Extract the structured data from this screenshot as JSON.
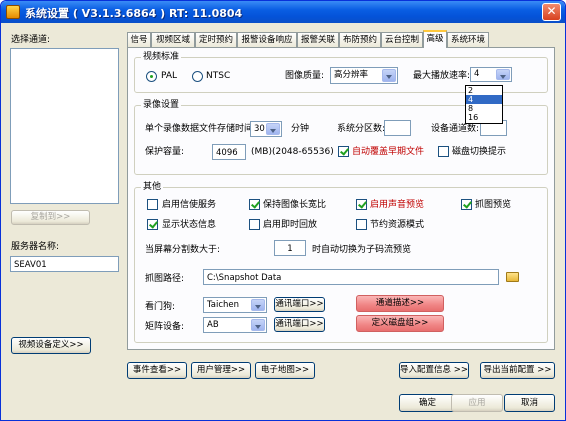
{
  "window": {
    "title": "系统设置 ( V3.1.3.6864 ) RT: 11.0804"
  },
  "left": {
    "select_channel_label": "选择通道:",
    "copy_to_button": "复制到>>",
    "server_name_label": "服务器名称:",
    "server_name_value": "SEAV01",
    "video_device_def_button": "视频设备定义>>"
  },
  "tabs": [
    {
      "label": "信号"
    },
    {
      "label": "视频区域"
    },
    {
      "label": "定时预约"
    },
    {
      "label": "报警设备响应"
    },
    {
      "label": "报警关联"
    },
    {
      "label": "布防预约"
    },
    {
      "label": "云台控制"
    },
    {
      "label": "高级"
    },
    {
      "label": "系统环境"
    }
  ],
  "video_std": {
    "group_title": "视频标准",
    "pal_label": "PAL",
    "ntsc_label": "NTSC",
    "quality_label": "图像质量:",
    "quality_value": "高分辨率",
    "max_rate_label": "最大播放速率:",
    "max_rate_value": "4",
    "rate_options": [
      "2",
      "4",
      "8",
      "16"
    ]
  },
  "record": {
    "group_title": "录像设置",
    "file_time_label": "单个录像数据文件存储时间:",
    "file_time_value": "30",
    "minutes_label": "分钟",
    "partitions_label": "系统分区数:",
    "partitions_value": "",
    "device_channels_label": "设备通道数:",
    "device_channels_value": "",
    "protect_label": "保护容量:",
    "protect_value": "4096",
    "protect_range": "(MB)(2048-65536)",
    "auto_overwrite_label": "自动覆盖早期文件",
    "disk_switch_label": "磁盘切换提示"
  },
  "other": {
    "group_title": "其他",
    "use_msg_service": "启用信使服务",
    "keep_ratio": "保持图像长宽比",
    "enable_sound_preview": "启用声音预览",
    "snap_preview": "抓图预览",
    "show_status": "显示状态信息",
    "enable_instant_playback": "启用即时回放",
    "save_mode": "节约资源模式",
    "split_label": "当屏幕分割数大于:",
    "split_value": "1",
    "split_suffix": "时自动切换为子码流预览",
    "snap_path_label": "抓图路径:",
    "snap_path_value": "C:\\Snapshot Data",
    "watchdog_label": "看门狗:",
    "watchdog_value": "Taichen",
    "watchdog_port_button": "通讯端口>>",
    "matrix_label": "矩阵设备:",
    "matrix_value": "AB",
    "matrix_port_button": "通讯端口>>",
    "channel_desc_button": "通道描述>>",
    "disk_group_button": "定义磁盘组>>"
  },
  "bottom": {
    "event_view": "事件查看>>",
    "user_mgmt": "用户管理>>",
    "emap": "电子地图>>",
    "import_config": "导入配置信息 >>",
    "export_config": "导出当前配置 >>",
    "ok": "确定",
    "apply": "应用",
    "cancel": "取消"
  }
}
